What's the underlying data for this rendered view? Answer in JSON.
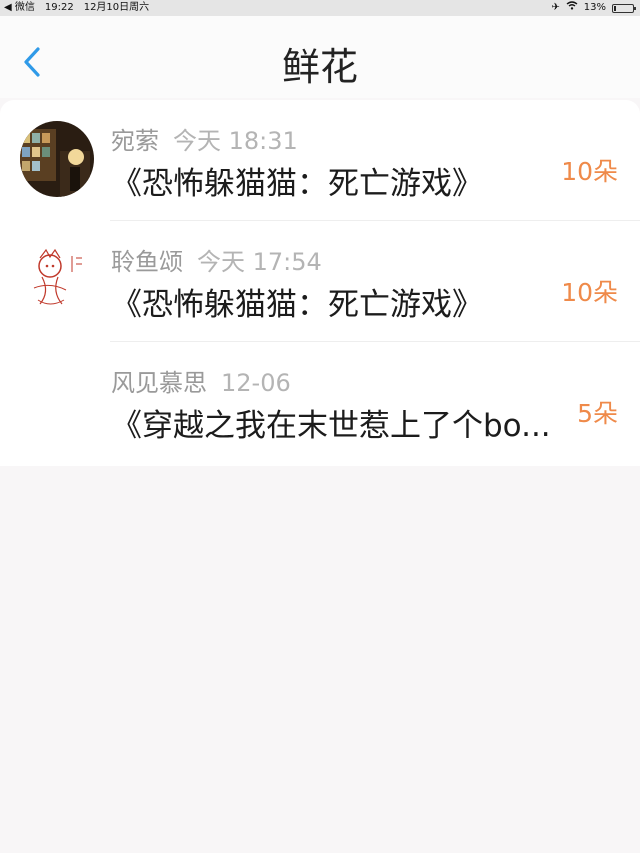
{
  "status_bar": {
    "back_app": "◀ 微信",
    "time": "19:22",
    "date": "12月10日周六",
    "battery": "13%",
    "battery_level": 0.13
  },
  "nav": {
    "title": "鲜花",
    "back_icon": "chevron-left-icon"
  },
  "items": [
    {
      "user": "宛萦",
      "time": "今天 18:31",
      "book": "《恐怖躲猫猫：死亡游戏》",
      "flowers": "10朵"
    },
    {
      "user": "聆鱼颂",
      "time": "今天 17:54",
      "book": "《恐怖躲猫猫：死亡游戏》",
      "flowers": "10朵"
    },
    {
      "user": "风见慕思",
      "time": "12-06",
      "book": "《穿越之我在末世惹上了个bo...",
      "flowers": "5朵"
    }
  ],
  "colors": {
    "accent_blue": "#2f9ae8",
    "flower_orange": "#ef8a4a"
  }
}
